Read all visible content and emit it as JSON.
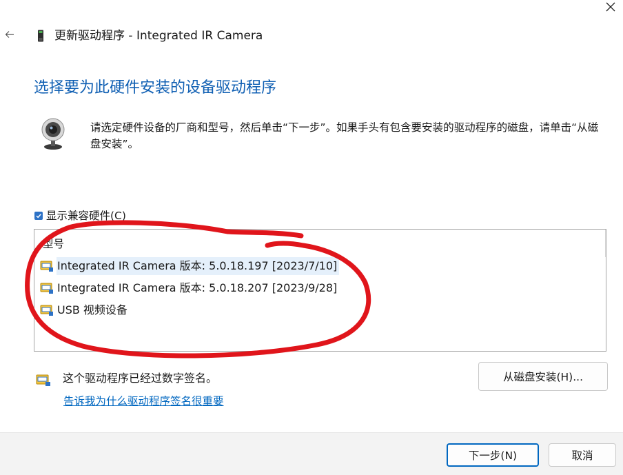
{
  "window": {
    "title": "更新驱动程序 - Integrated IR Camera",
    "back_icon": "arrow-left-icon",
    "close_icon": "close-icon"
  },
  "heading": "选择要为此硬件安装的设备驱动程序",
  "instructions": "请选定硬件设备的厂商和型号，然后单击“下一步”。如果手头有包含要安装的驱动程序的磁盘，请单击“从磁盘安装”。",
  "show_compatible": {
    "label": "显示兼容硬件(C)",
    "checked": true
  },
  "model_list": {
    "header": "型号",
    "items": [
      {
        "label": "Integrated IR Camera 版本: 5.0.18.197 [2023/7/10]",
        "selected": true
      },
      {
        "label": "Integrated IR Camera 版本: 5.0.18.207 [2023/9/28]",
        "selected": false
      },
      {
        "label": "USB 视频设备",
        "selected": false
      }
    ]
  },
  "signature": {
    "text": "这个驱动程序已经过数字签名。",
    "link": "告诉我为什么驱动程序签名很重要"
  },
  "buttons": {
    "have_disk": "从磁盘安装(H)...",
    "next": "下一步(N)",
    "cancel": "取消"
  },
  "colors": {
    "heading": "#0f5fb3",
    "link": "#0067c0",
    "checkbox": "#2d72c6",
    "annotation": "#e0151b",
    "footer_bg": "#f3f3f3"
  }
}
